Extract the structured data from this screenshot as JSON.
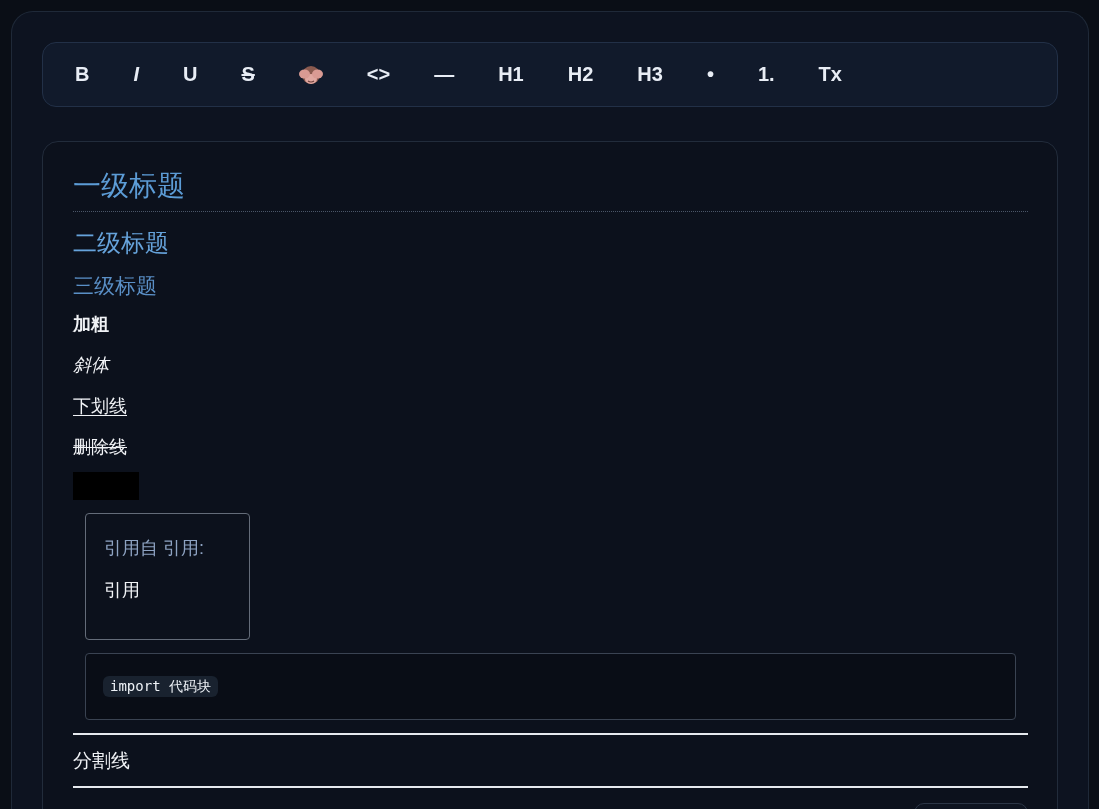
{
  "toolbar": {
    "buttons": [
      {
        "kind": "text",
        "label": "B"
      },
      {
        "kind": "italic",
        "label": "I"
      },
      {
        "kind": "text",
        "label": "U"
      },
      {
        "kind": "strike",
        "label": "S"
      },
      {
        "kind": "emoji"
      },
      {
        "kind": "text",
        "label": "<>"
      },
      {
        "kind": "text",
        "label": "—"
      },
      {
        "kind": "text",
        "label": "H1"
      },
      {
        "kind": "text",
        "label": "H2"
      },
      {
        "kind": "text",
        "label": "H3"
      },
      {
        "kind": "text",
        "label": "•"
      },
      {
        "kind": "text",
        "label": "1."
      },
      {
        "kind": "text",
        "label": "Tx"
      }
    ]
  },
  "editor": {
    "blocks": [
      {
        "kind": "h1",
        "text": "一级标题"
      },
      {
        "kind": "h2",
        "text": "二级标题"
      },
      {
        "kind": "h3",
        "text": "三级标题"
      },
      {
        "kind": "bold",
        "text": "加粗"
      },
      {
        "kind": "italic",
        "text": "斜体"
      },
      {
        "kind": "underline",
        "text": "下划线"
      },
      {
        "kind": "strike",
        "text": "删除线"
      },
      {
        "kind": "spoiler"
      },
      {
        "kind": "quote",
        "source": "引用自 引用:",
        "text": "引用"
      },
      {
        "kind": "code",
        "text": "import 代码块"
      },
      {
        "kind": "hr"
      },
      {
        "kind": "paragraph",
        "text": "分割线"
      },
      {
        "kind": "hr"
      }
    ]
  }
}
